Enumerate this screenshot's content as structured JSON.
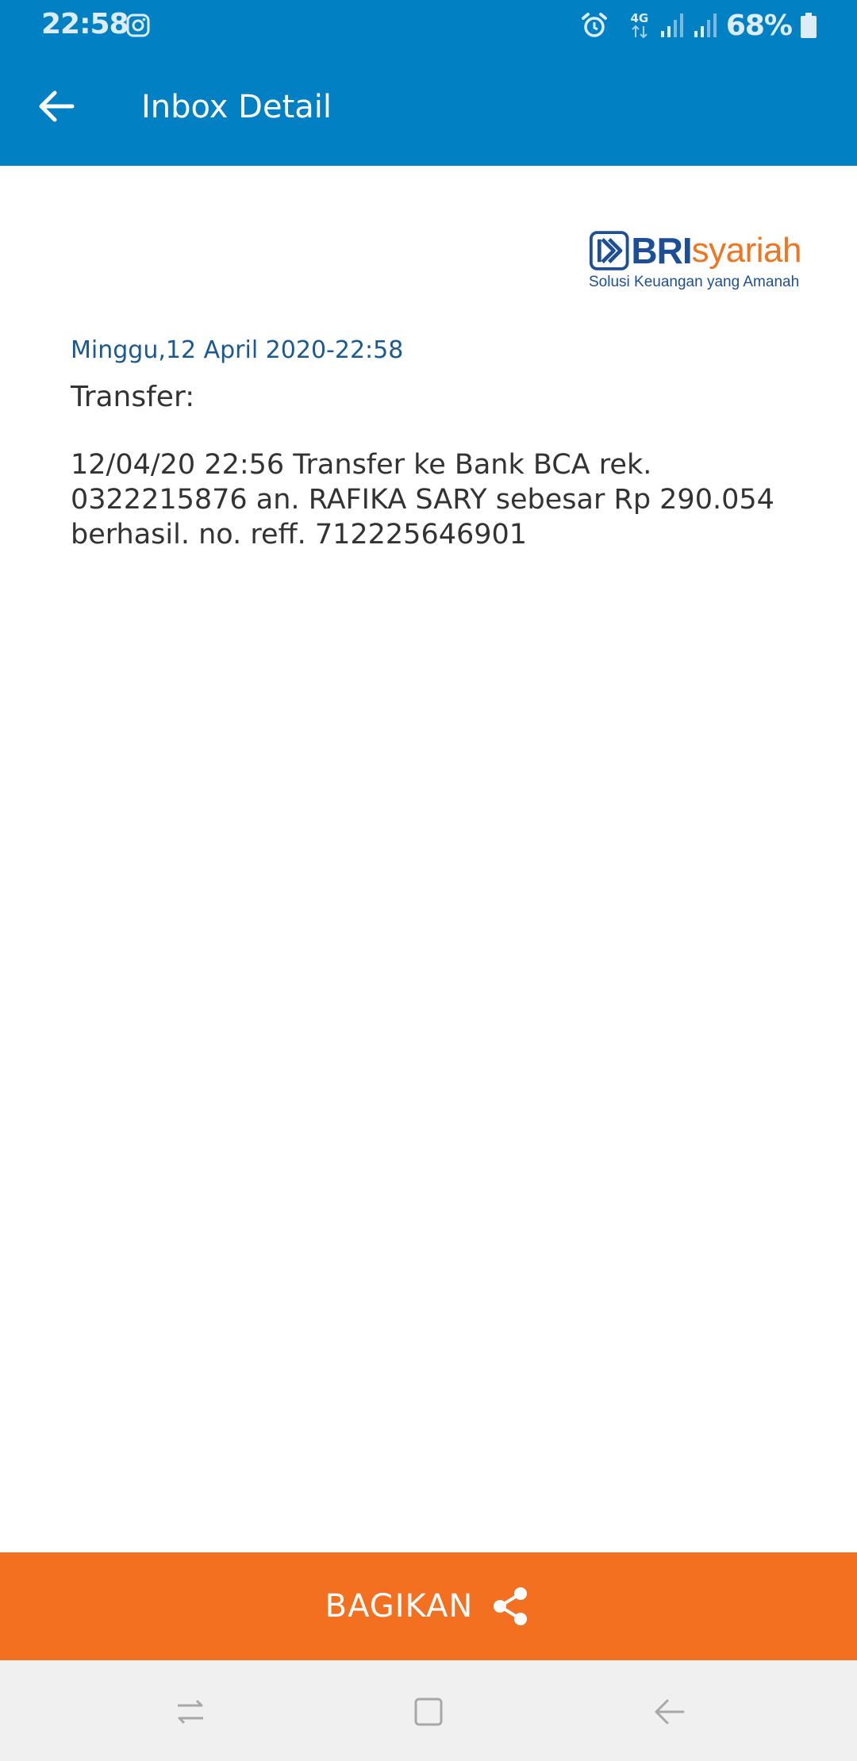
{
  "status_bar": {
    "time": "22:58",
    "network": "4G",
    "battery": "68%"
  },
  "app_bar": {
    "title": "Inbox Detail"
  },
  "logo": {
    "brand_primary": "BRI",
    "brand_secondary": "syariah",
    "tagline": "Solusi Keuangan yang Amanah"
  },
  "message": {
    "date": "Minggu,12 April 2020-22:58",
    "subject": "Transfer:",
    "body": "12/04/20 22:56 Transfer ke Bank BCA rek. 0322215876 an. RAFIKA SARY sebesar Rp 290.054 berhasil. no. reff. 712225646901"
  },
  "share": {
    "label": "BAGIKAN"
  },
  "colors": {
    "header_blue": "#0180c3",
    "share_orange": "#f37021",
    "brand_navy": "#1d4f96",
    "brand_orange": "#f07520",
    "date_blue": "#1a5a94",
    "text_dark": "#333333"
  },
  "icons": {
    "back": "arrow-left-icon",
    "share": "share-icon",
    "instagram": "instagram-icon",
    "alarm": "alarm-icon",
    "signal": "signal-icon",
    "battery": "battery-icon",
    "nav_recent": "recent-apps-icon",
    "nav_home": "home-icon",
    "nav_back": "nav-back-icon"
  }
}
